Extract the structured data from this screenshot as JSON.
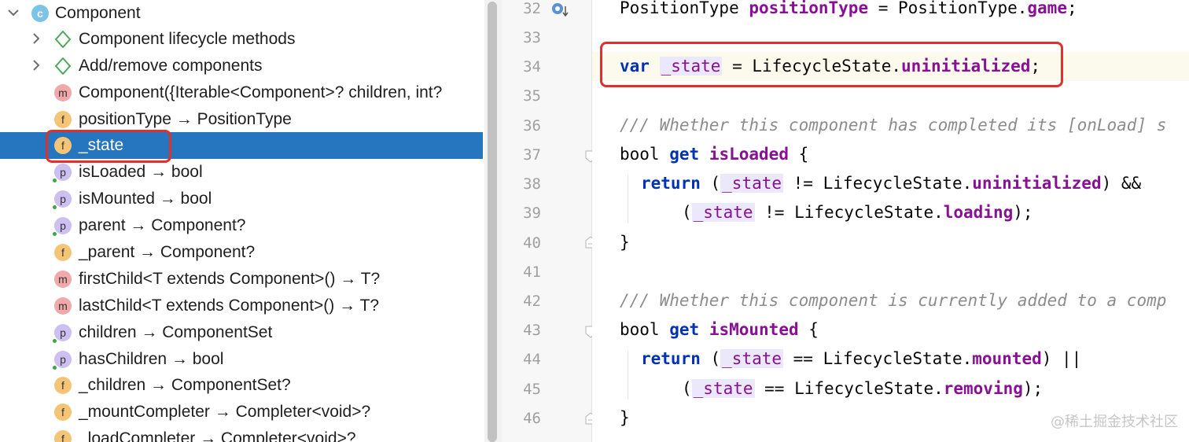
{
  "structure": {
    "root": {
      "label": "Component",
      "icon": "class-icon",
      "icon_letter": "c"
    },
    "groups": [
      {
        "label": "Component lifecycle methods"
      },
      {
        "label": "Add/remove components"
      }
    ],
    "items": [
      {
        "kind": "m",
        "label": "Component({Iterable<Component>? children, int?"
      },
      {
        "kind": "f",
        "label": "positionType → PositionType"
      },
      {
        "kind": "f",
        "label": "_state",
        "selected": true
      },
      {
        "kind": "p",
        "label": "isLoaded → bool"
      },
      {
        "kind": "p",
        "label": "isMounted → bool"
      },
      {
        "kind": "p",
        "label": "parent → Component?"
      },
      {
        "kind": "f",
        "label": "_parent → Component?"
      },
      {
        "kind": "m",
        "label": "firstChild<T extends Component>() → T?"
      },
      {
        "kind": "m",
        "label": "lastChild<T extends Component>() → T?"
      },
      {
        "kind": "p",
        "label": "children → ComponentSet"
      },
      {
        "kind": "p",
        "label": "hasChildren → bool"
      },
      {
        "kind": "f",
        "label": "_children → ComponentSet?"
      },
      {
        "kind": "f",
        "label": "_mountCompleter → Completer<void>?"
      },
      {
        "kind": "f",
        "label": "_loadCompleter → Completer<void>?"
      }
    ]
  },
  "editor": {
    "line_numbers": [
      "32",
      "33",
      "34",
      "35",
      "36",
      "37",
      "38",
      "39",
      "40",
      "41",
      "42",
      "43",
      "44",
      "45",
      "46"
    ],
    "code": {
      "l32": {
        "type": "PositionType ",
        "name": "positionType",
        "eq": " = PositionType.",
        "val": "game",
        "end": ";"
      },
      "l34": {
        "kw": "var",
        "sp": " ",
        "name": "_state",
        "eq": " = LifecycleState.",
        "val": "uninitialized",
        "end": ";"
      },
      "l36": {
        "comment_a": "/// Whether this component has completed its [",
        "comment_ref": "onLoad",
        "comment_b": "] s"
      },
      "l37": {
        "type": "bool ",
        "kw": "get",
        "sp": " ",
        "name": "isLoaded",
        "end": " {"
      },
      "l38": {
        "kw": "return",
        "a": " (",
        "st": "_state",
        "b": " != LifecycleState.",
        "val": "uninitialized",
        "c": ") &&"
      },
      "l39": {
        "a": "(",
        "st": "_state",
        "b": " != LifecycleState.",
        "val": "loading",
        "c": ");"
      },
      "l40": {
        "a": "}"
      },
      "l42": {
        "comment_a": "/// Whether this component is currently added to a comp"
      },
      "l43": {
        "type": "bool ",
        "kw": "get",
        "sp": " ",
        "name": "isMounted",
        "end": " {"
      },
      "l44": {
        "kw": "return",
        "a": " (",
        "st": "_state",
        "b": " == LifecycleState.",
        "val": "mounted",
        "c": ") ||"
      },
      "l45": {
        "a": "(",
        "st": "_state",
        "b": " == LifecycleState.",
        "val": "removing",
        "c": ");"
      },
      "l46": {
        "a": "}"
      }
    }
  },
  "watermark": "@稀土掘金技术社区",
  "colors": {
    "selection": "#2675bf",
    "highlight_box": "#e0302b",
    "keyword": "#0033b3",
    "field": "#871094",
    "comment": "#8c8c8c"
  }
}
